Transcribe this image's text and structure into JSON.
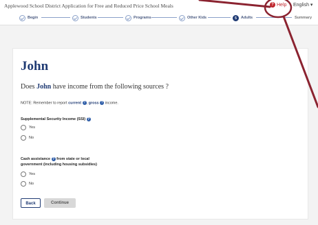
{
  "header": {
    "title": "Applewood School District Application for Free and Reduced Price School Meals",
    "help_label": "Help",
    "help_icon": "question-circle-icon",
    "language_label": "English ▾"
  },
  "stepper": {
    "steps": [
      {
        "label": "Begin",
        "state": "done"
      },
      {
        "label": "Students",
        "state": "done"
      },
      {
        "label": "Programs",
        "state": "done"
      },
      {
        "label": "Other Kids",
        "state": "done"
      },
      {
        "label": "Adults",
        "state": "current",
        "number": "5"
      },
      {
        "label": "Summary",
        "state": "upcoming"
      }
    ]
  },
  "main": {
    "name": "John",
    "question_prefix": "Does ",
    "question_name": "John",
    "question_suffix": " have income from the following sources ?",
    "note_prefix": "NOTE: Remember to report ",
    "note_current": "current",
    "note_gross": "gross",
    "note_suffix": " income.",
    "ssi": {
      "label": "Supplemental Security Income (SSI)",
      "options": [
        "Yes",
        "No"
      ]
    },
    "cash": {
      "label_part1": "Cash assistance",
      "label_part2": " from state or local",
      "label_line2": "government (including housing subsidies)",
      "options": [
        "Yes",
        "No"
      ]
    },
    "buttons": {
      "back": "Back",
      "continue": "Continue"
    }
  },
  "colors": {
    "accent": "#1f3a73",
    "help": "#c0262d",
    "annotation": "#8b2330"
  }
}
